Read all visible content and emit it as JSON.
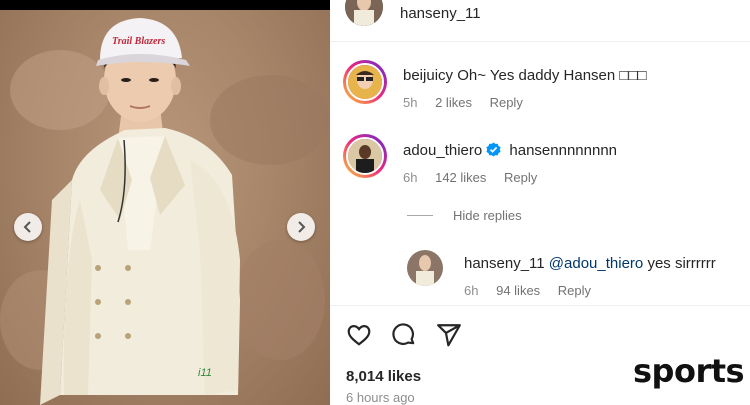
{
  "post": {
    "author": "hanseny_11",
    "likes": "8,014 likes",
    "time": "6 hours ago"
  },
  "comments": [
    {
      "username": "beijuicy",
      "text": "Oh~ Yes daddy Hansen □□□",
      "time": "5h",
      "likes": "2 likes",
      "reply_label": "Reply"
    },
    {
      "username": "adou_thiero",
      "text": "hansennnnnnnn",
      "time": "6h",
      "likes": "142 likes",
      "reply_label": "Reply",
      "verified": true
    }
  ],
  "hide_replies_label": "Hide replies",
  "reply": {
    "username": "hanseny_11",
    "mention": "@adou_thiero",
    "text": "yes sirrrrrr",
    "time": "6h",
    "likes": "94 likes",
    "reply_label": "Reply"
  },
  "actions": {
    "like_icon": "heart-icon",
    "comment_icon": "comment-icon",
    "share_icon": "share-icon"
  },
  "photo": {
    "hat_text": "Trail Blazers",
    "sleeve_text": "i11"
  },
  "watermark": "sports",
  "colors": {
    "verified": "#0095f6",
    "mention": "#00376b",
    "muted": "#737373",
    "text": "#262626"
  }
}
